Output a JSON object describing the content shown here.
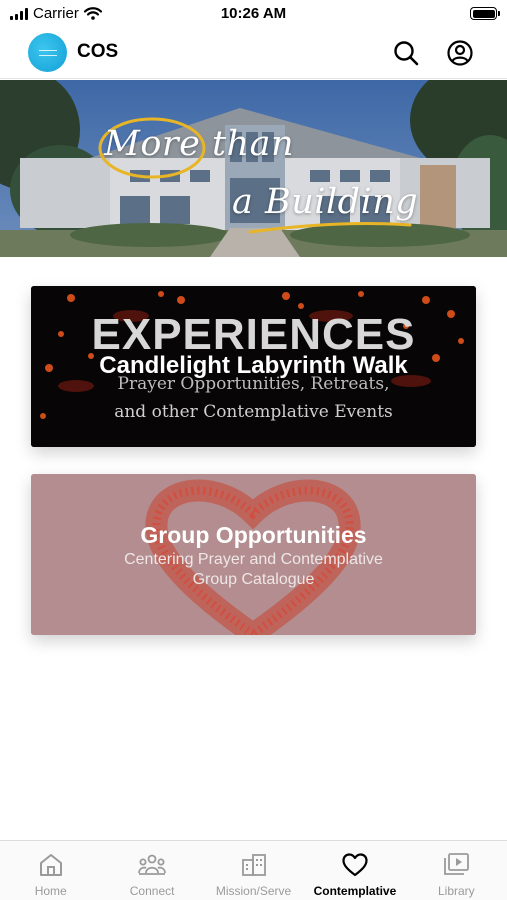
{
  "status_bar": {
    "carrier": "Carrier",
    "time": "10:26 AM"
  },
  "header": {
    "app_title": "COS",
    "search_icon": "search-icon",
    "account_icon": "account-icon"
  },
  "hero": {
    "line1": "More than",
    "line2": "a Building"
  },
  "cards": {
    "experiences": {
      "heading": "EXPERIENCES",
      "title": "Candlelight Labyrinth Walk",
      "subtitle_line1": "Prayer Opportunities, Retreats,",
      "subtitle_line2": "and other Contemplative Events"
    },
    "groups": {
      "title": "Group Opportunities",
      "subtitle_line1": "Centering Prayer and Contemplative",
      "subtitle_line2": "Group Catalogue"
    }
  },
  "tabs": [
    {
      "label": "Home",
      "icon": "home-icon",
      "active": false
    },
    {
      "label": "Connect",
      "icon": "people-icon",
      "active": false
    },
    {
      "label": "Mission/Serve",
      "icon": "building-icon",
      "active": false
    },
    {
      "label": "Contemplative",
      "icon": "heart-icon",
      "active": true
    },
    {
      "label": "Library",
      "icon": "video-library-icon",
      "active": false
    }
  ],
  "colors": {
    "accent_blue": "#1fb0e3",
    "active_tab": "#000000",
    "inactive_tab": "#9a9a9a",
    "hero_ring": "#e8b526",
    "card_groups_bg": "#b38d8f"
  }
}
